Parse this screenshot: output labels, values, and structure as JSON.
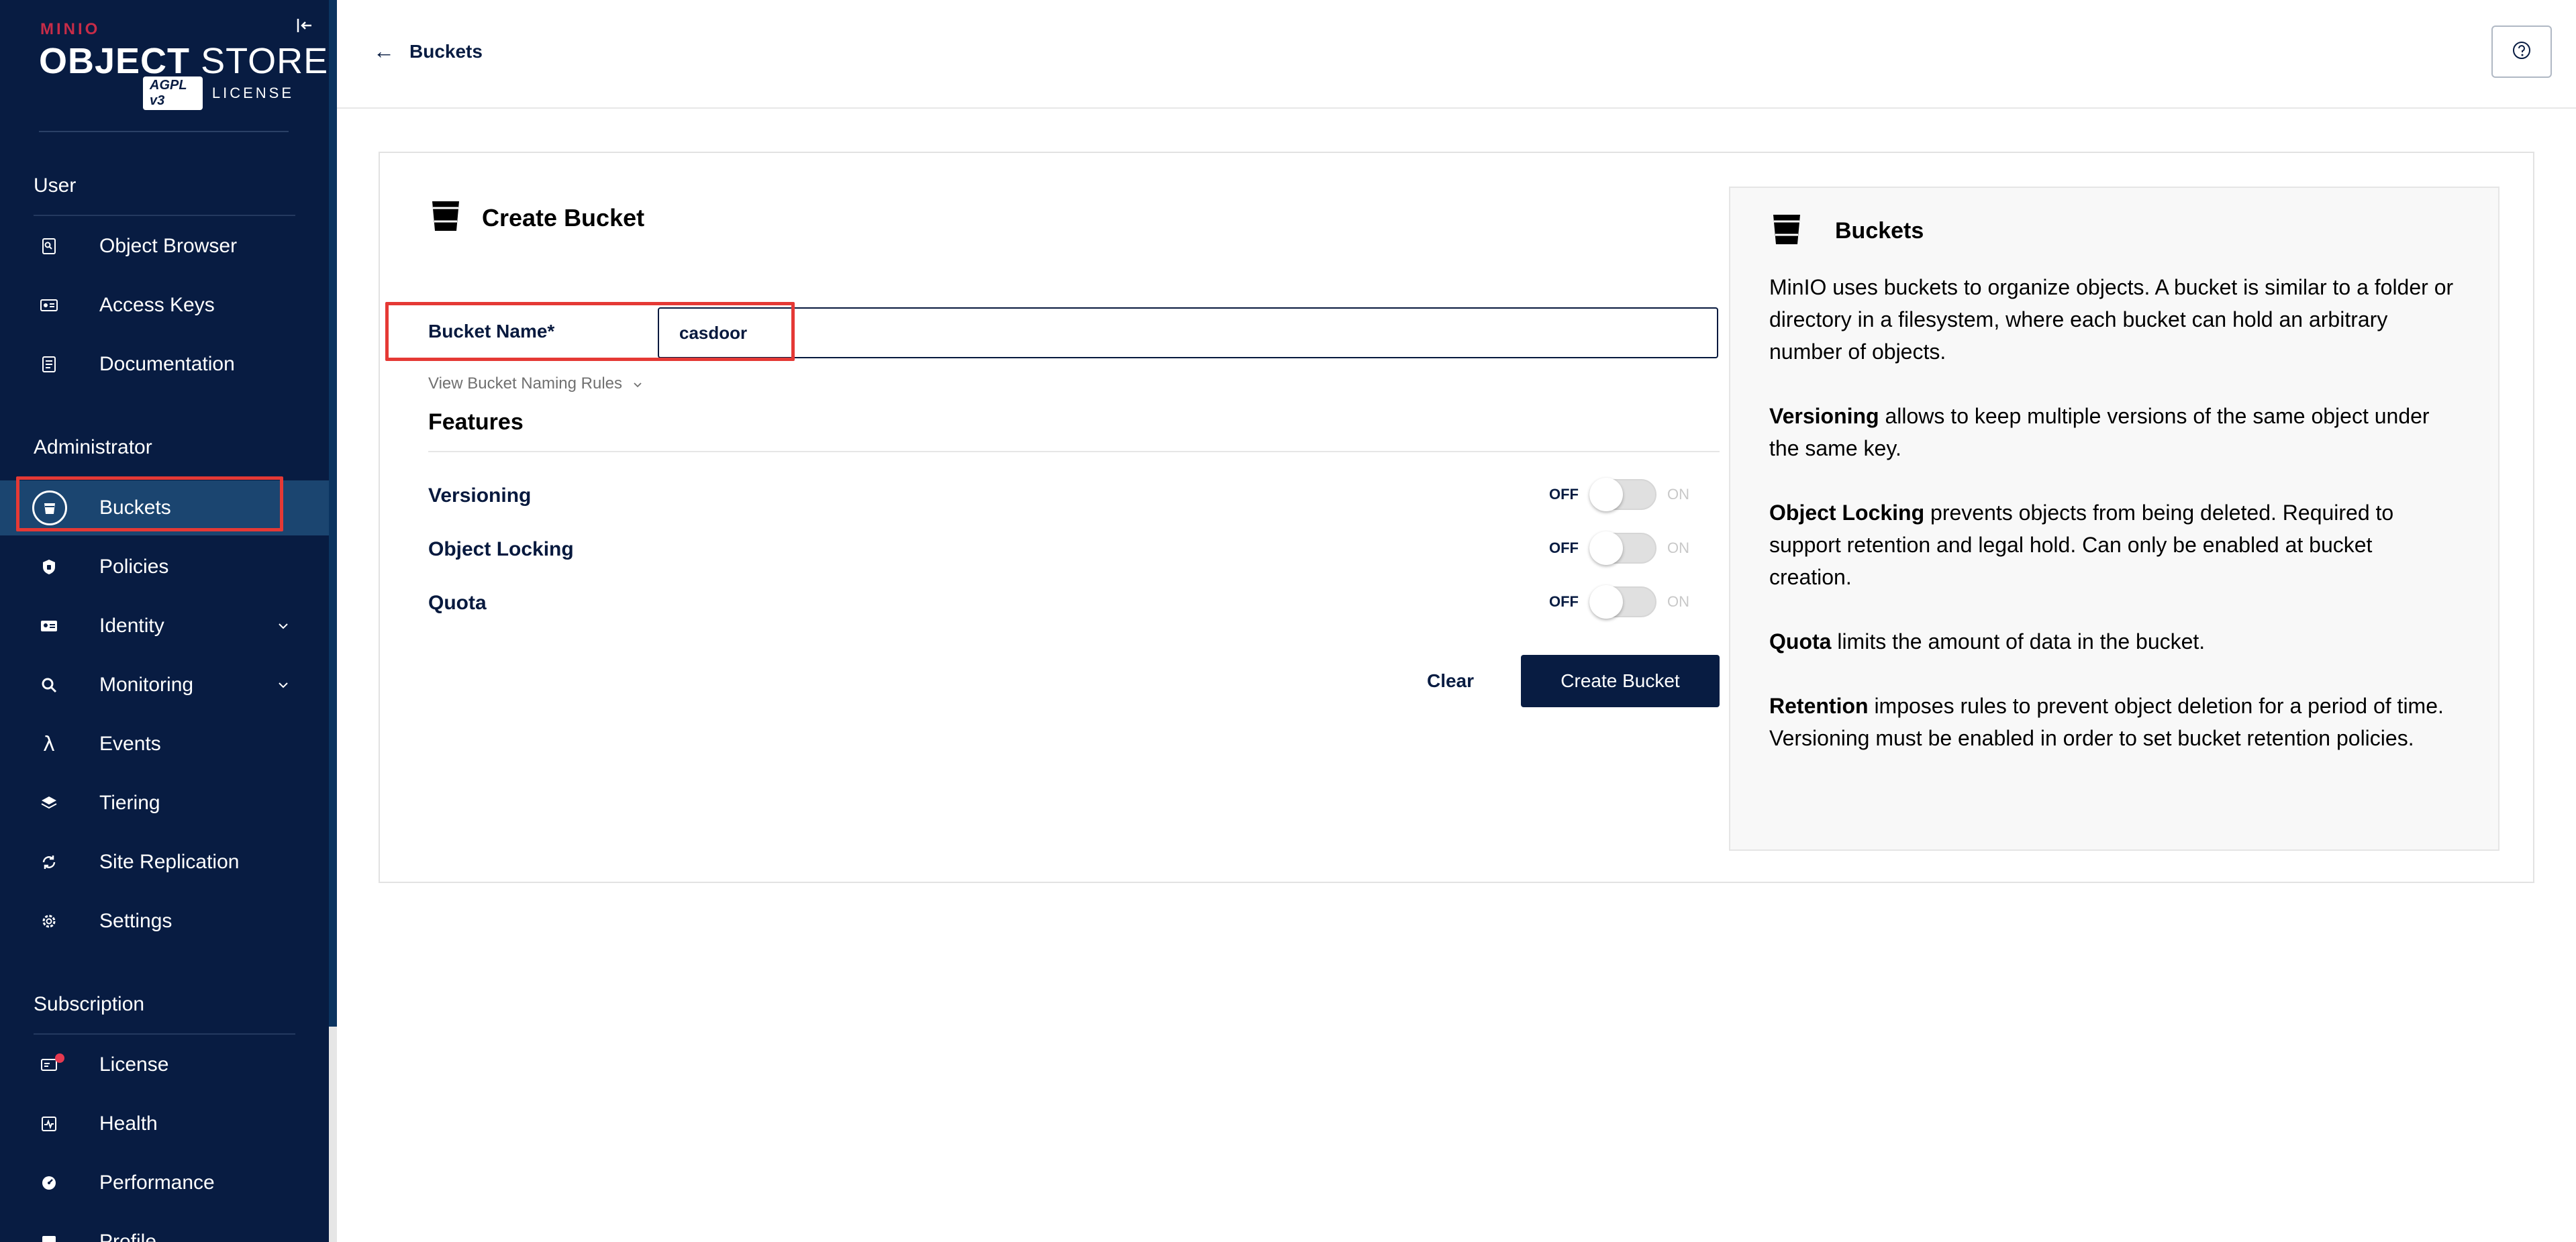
{
  "sidebar": {
    "logo": {
      "brand": "MINIO",
      "title_bold": "OBJECT",
      "title_light": "STORE",
      "badge": "AGPL v3",
      "license": "LICENSE"
    },
    "sections": {
      "user": "User",
      "administrator": "Administrator",
      "subscription": "Subscription"
    },
    "user_items": [
      {
        "label": "Object Browser",
        "icon": "object-browser-icon"
      },
      {
        "label": "Access Keys",
        "icon": "access-keys-icon"
      },
      {
        "label": "Documentation",
        "icon": "documentation-icon"
      }
    ],
    "admin_items": [
      {
        "label": "Buckets",
        "icon": "bucket-icon",
        "active": true
      },
      {
        "label": "Policies",
        "icon": "shield-icon"
      },
      {
        "label": "Identity",
        "icon": "identity-icon",
        "expandable": true
      },
      {
        "label": "Monitoring",
        "icon": "magnifier-icon",
        "expandable": true
      },
      {
        "label": "Events",
        "icon": "lambda-icon"
      },
      {
        "label": "Tiering",
        "icon": "layers-icon"
      },
      {
        "label": "Site Replication",
        "icon": "sync-icon"
      },
      {
        "label": "Settings",
        "icon": "gear-icon"
      }
    ],
    "subscription_items": [
      {
        "label": "License",
        "icon": "license-icon"
      },
      {
        "label": "Health",
        "icon": "health-icon"
      },
      {
        "label": "Performance",
        "icon": "speedometer-icon"
      },
      {
        "label": "Profile",
        "icon": "profile-icon"
      }
    ]
  },
  "topbar": {
    "back_label": "Buckets",
    "help_icon": "question-icon"
  },
  "form": {
    "title": "Create Bucket",
    "bucket_name_label": "Bucket Name*",
    "bucket_name_value": "casdoor",
    "naming_rules_label": "View Bucket Naming Rules",
    "features_title": "Features",
    "features": [
      {
        "label": "Versioning",
        "off": "OFF",
        "on": "ON",
        "enabled": false
      },
      {
        "label": "Object Locking",
        "off": "OFF",
        "on": "ON",
        "enabled": false
      },
      {
        "label": "Quota",
        "off": "OFF",
        "on": "ON",
        "enabled": false
      }
    ],
    "clear_label": "Clear",
    "create_label": "Create Bucket"
  },
  "help": {
    "title": "Buckets",
    "p1": "MinIO uses buckets to organize objects. A bucket is similar to a folder or directory in a filesystem, where each bucket can hold an arbitrary number of objects.",
    "p2_bold": "Versioning",
    "p2": " allows to keep multiple versions of the same object under the same key.",
    "p3_bold": "Object Locking",
    "p3": " prevents objects from being deleted. Required to support retention and legal hold. Can only be enabled at bucket creation.",
    "p4_bold": "Quota",
    "p4": " limits the amount of data in the bucket.",
    "p5_bold": "Retention",
    "p5": " imposes rules to prevent object deletion for a period of time. Versioning must be enabled in order to set bucket retention policies."
  },
  "colors": {
    "sidebar_bg": "#081c42",
    "active_item_bg": "#1b4570",
    "primary_button": "#081c42",
    "highlight_red": "#e53935"
  }
}
